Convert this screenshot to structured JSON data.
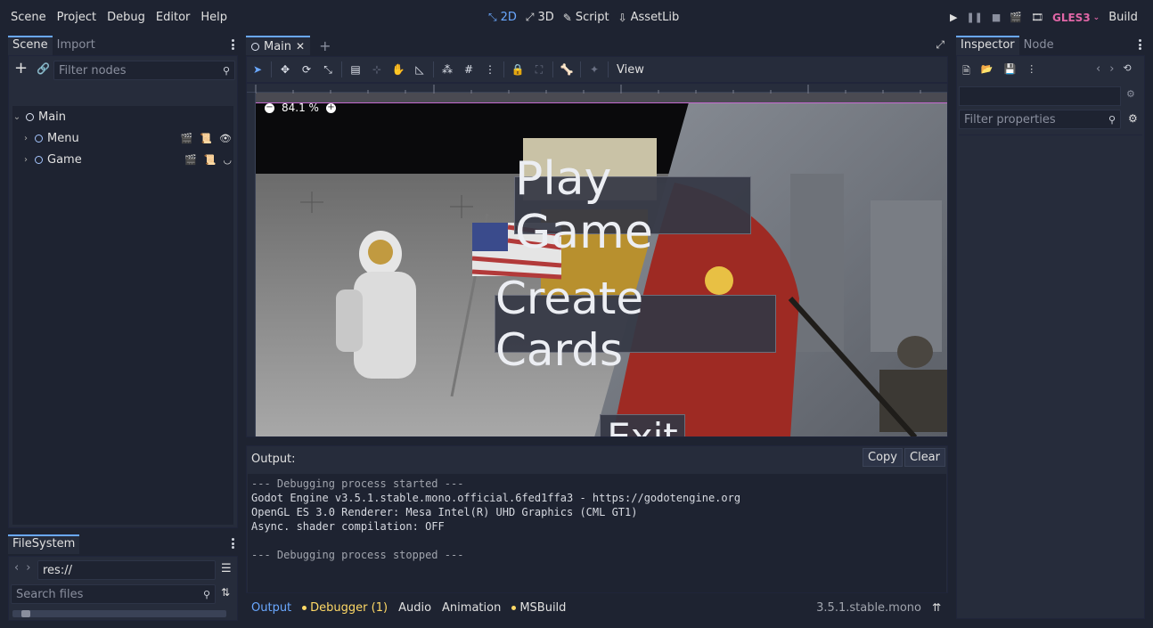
{
  "menu": [
    "Scene",
    "Project",
    "Debug",
    "Editor",
    "Help"
  ],
  "main_tabs": [
    {
      "label": "2D",
      "active": true,
      "icon": "2d-icon"
    },
    {
      "label": "3D",
      "active": false,
      "icon": "3d-icon"
    },
    {
      "label": "Script",
      "active": false,
      "icon": "script-icon"
    },
    {
      "label": "AssetLib",
      "active": false,
      "icon": "assetlib-icon"
    }
  ],
  "renderer": "GLES3",
  "build_label": "Build",
  "scene_dock": {
    "tabs": [
      "Scene",
      "Import"
    ],
    "filter_placeholder": "Filter nodes",
    "root": "Main",
    "children": [
      "Menu",
      "Game"
    ]
  },
  "filesystem": {
    "title": "FileSystem",
    "path": "res://",
    "search_placeholder": "Search files"
  },
  "editor_tab": "Main",
  "zoom": "84.1 %",
  "view_label": "View",
  "scene_buttons": {
    "play": "Play Game",
    "create": "Create Cards",
    "exit": "Exit"
  },
  "output": {
    "title": "Output:",
    "copy": "Copy",
    "clear": "Clear",
    "lines": [
      "--- Debugging process started ---",
      "Godot Engine v3.5.1.stable.mono.official.6fed1ffa3 - https://godotengine.org",
      "OpenGL ES 3.0 Renderer: Mesa Intel(R) UHD Graphics (CML GT1)",
      "Async. shader compilation: OFF",
      "",
      "--- Debugging process stopped ---"
    ]
  },
  "bottom_tabs": [
    "Output",
    "Debugger (1)",
    "Audio",
    "Animation",
    "MSBuild"
  ],
  "version": "3.5.1.stable.mono",
  "inspector": {
    "tabs": [
      "Inspector",
      "Node"
    ],
    "filter_placeholder": "Filter properties"
  },
  "colors": {
    "accent": "#6aa8ff",
    "renderer": "#e066a6",
    "warning": "#ffd966"
  }
}
